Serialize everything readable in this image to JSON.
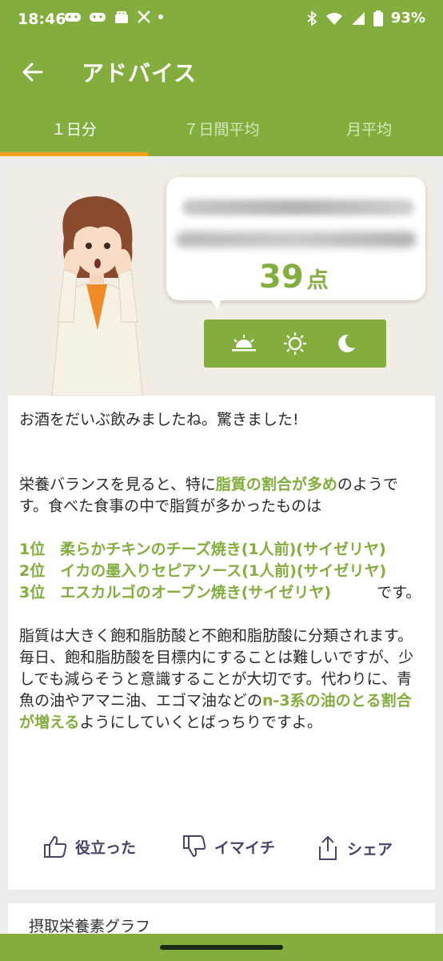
{
  "status_bar": {
    "time": "18:46",
    "battery": "93%"
  },
  "app_bar": {
    "title": "アドバイス"
  },
  "tabs": [
    {
      "label": "１日分",
      "active": true
    },
    {
      "label": "７日間平均",
      "active": false
    },
    {
      "label": "月平均",
      "active": false
    }
  ],
  "score": {
    "value": "39",
    "unit": "点"
  },
  "time_of_day": [
    "sunrise",
    "sun",
    "moon"
  ],
  "advice": {
    "line1": "お酒をだいぶ飲みましたね。驚きました!",
    "p2_pre": "栄養バランスを見ると、特に",
    "p2_highlight": "脂質の割合が多め",
    "p2_post": "のようです。食べた食事の中で脂質が多かったものは",
    "rank1": "1位　柔らかチキンのチーズ焼き(1人前)(サイゼリヤ)",
    "rank2": "2位　イカの墨入りセピアソース(1人前)(サイゼリヤ)",
    "rank3": "3位　エスカルゴのオーブン焼き(サイゼリヤ)",
    "rank_suffix": "です。",
    "p4_pre": "脂質は大きく飽和脂肪酸と不飽和脂肪酸に分類されます。毎日、飽和脂肪酸を目標内にすることは難しいですが、少しでも減らそうと意識することが大切です。代わりに、青魚の油やアマニ油、エゴマ油などの",
    "p4_highlight": "n-3系の油のとる割合が増える",
    "p4_post": "ようにしていくとばっちりですよ。"
  },
  "actions": {
    "helpful": "役立った",
    "not_good": "イマイチ",
    "share": "シェア"
  },
  "next_section": {
    "title": "摂取栄養素グラフ"
  },
  "colors": {
    "accent": "#83ae3e",
    "tab_indicator": "#f2a31a",
    "action_text": "#4b4268"
  }
}
